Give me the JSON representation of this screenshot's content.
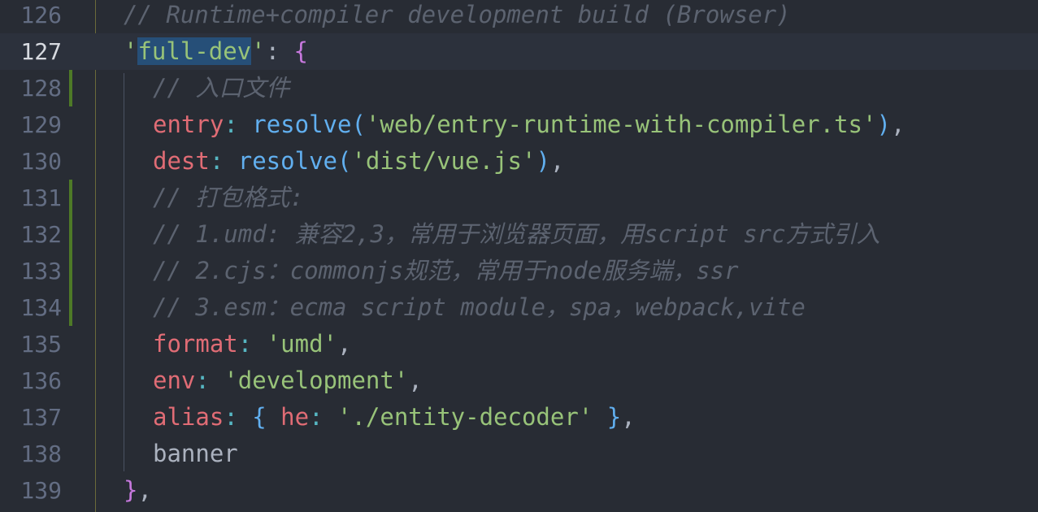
{
  "editor": {
    "lines": [
      {
        "number": "126",
        "tokens": [
          {
            "text": "// Runtime+compiler development build (Browser)",
            "kind": "comment"
          }
        ]
      },
      {
        "number": "127",
        "tokens": [
          {
            "text": "'",
            "kind": "string"
          },
          {
            "text": "full-dev",
            "kind": "hl"
          },
          {
            "text": "'",
            "kind": "string"
          },
          {
            "text": ": ",
            "kind": "punc"
          },
          {
            "text": "{",
            "kind": "brace-mag"
          }
        ]
      },
      {
        "number": "128",
        "tokens": [
          {
            "text": "// 入口文件",
            "kind": "comment"
          }
        ]
      },
      {
        "number": "129",
        "tokens": [
          {
            "text": "entry",
            "kind": "prop"
          },
          {
            "text": ": ",
            "kind": "colon"
          },
          {
            "text": "resolve",
            "kind": "func"
          },
          {
            "text": "(",
            "kind": "paren"
          },
          {
            "text": "'web/entry-runtime-with-compiler.ts'",
            "kind": "string"
          },
          {
            "text": ")",
            "kind": "paren"
          },
          {
            "text": ",",
            "kind": "punc"
          }
        ]
      },
      {
        "number": "130",
        "tokens": [
          {
            "text": "dest",
            "kind": "prop"
          },
          {
            "text": ": ",
            "kind": "colon"
          },
          {
            "text": "resolve",
            "kind": "func"
          },
          {
            "text": "(",
            "kind": "paren"
          },
          {
            "text": "'dist/vue.js'",
            "kind": "string"
          },
          {
            "text": ")",
            "kind": "paren"
          },
          {
            "text": ",",
            "kind": "punc"
          }
        ]
      },
      {
        "number": "131",
        "tokens": [
          {
            "text": "// 打包格式:",
            "kind": "comment"
          }
        ]
      },
      {
        "number": "132",
        "tokens": [
          {
            "text": "// 1.umd: 兼容2,3，常用于浏览器页面，用script src方式引入",
            "kind": "comment"
          }
        ]
      },
      {
        "number": "133",
        "tokens": [
          {
            "text": "// 2.cjs：commonjs规范，常用于node服务端，ssr",
            "kind": "comment"
          }
        ]
      },
      {
        "number": "134",
        "tokens": [
          {
            "text": "// 3.esm：ecma script module，spa，webpack,vite",
            "kind": "comment"
          }
        ]
      },
      {
        "number": "135",
        "tokens": [
          {
            "text": "format",
            "kind": "prop"
          },
          {
            "text": ": ",
            "kind": "colon"
          },
          {
            "text": "'umd'",
            "kind": "string"
          },
          {
            "text": ",",
            "kind": "punc"
          }
        ]
      },
      {
        "number": "136",
        "tokens": [
          {
            "text": "env",
            "kind": "prop"
          },
          {
            "text": ": ",
            "kind": "colon"
          },
          {
            "text": "'development'",
            "kind": "string"
          },
          {
            "text": ",",
            "kind": "punc"
          }
        ]
      },
      {
        "number": "137",
        "tokens": [
          {
            "text": "alias",
            "kind": "prop"
          },
          {
            "text": ": ",
            "kind": "colon"
          },
          {
            "text": "{ ",
            "kind": "brace-blue"
          },
          {
            "text": "he",
            "kind": "prop"
          },
          {
            "text": ": ",
            "kind": "colon"
          },
          {
            "text": "'./entity-decoder'",
            "kind": "string"
          },
          {
            "text": " }",
            "kind": "brace-blue"
          },
          {
            "text": ",",
            "kind": "punc"
          }
        ]
      },
      {
        "number": "138",
        "tokens": [
          {
            "text": "banner",
            "kind": "ident"
          }
        ]
      },
      {
        "number": "139",
        "tokens": [
          {
            "text": "}",
            "kind": "brace-mag"
          },
          {
            "text": ",",
            "kind": "punc"
          }
        ]
      }
    ],
    "active_line": "127",
    "colors": {
      "background": "#282c34",
      "comment": "#5c6370",
      "string": "#98c379",
      "property": "#e06c75",
      "function": "#61afef",
      "keyword_brace": "#c678dd",
      "line_number": "#636d83",
      "git_modified": "#4e7a27"
    }
  }
}
